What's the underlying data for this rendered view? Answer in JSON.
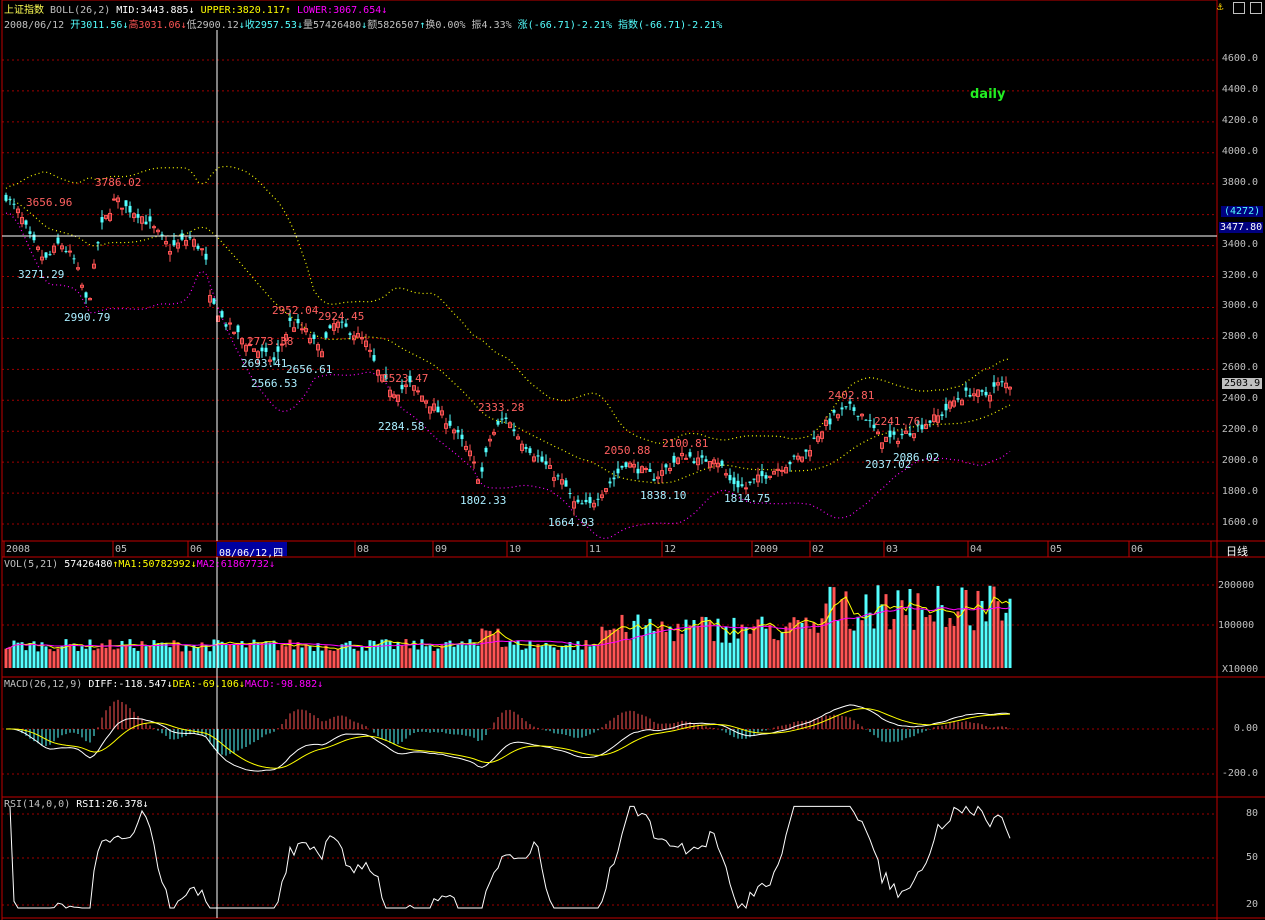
{
  "header": {
    "name": "上证指数",
    "boll_label": "BOLL(26,2)",
    "mid": "MID:3443.885",
    "upper": "UPPER:3820.117",
    "lower": "LOWER:3067.654",
    "date": "2008/06/12",
    "open": "开3011.56",
    "high": "高3031.06",
    "low": "低2900.12",
    "close": "收2957.53",
    "volume": "量57426480",
    "amount": "额5826507",
    "turnover": "换0.00%",
    "amplitude": "振4.33%",
    "change": "涨(-66.71)-2.21%",
    "index_change": "指数(-66.71)-2.21%"
  },
  "period_label": "daily",
  "price_axis": [
    "4600.0",
    "4400.0",
    "4200.0",
    "4000.0",
    "3800.0",
    "3600.0",
    "3400.0",
    "3200.0",
    "3000.0",
    "2800.0",
    "2600.0",
    "2400.0",
    "2200.0",
    "2000.0",
    "1800.0",
    "1600.0"
  ],
  "price_boxes": {
    "count": "(4272)",
    "crosshair_value": "3477.80",
    "last_price": "2503.9"
  },
  "annotations": [
    {
      "text": "3656.96",
      "kind": "hi"
    },
    {
      "text": "3786.02",
      "kind": "hi"
    },
    {
      "text": "3271.29",
      "kind": "lo"
    },
    {
      "text": "2990.79",
      "kind": "lo"
    },
    {
      "text": "2952.04",
      "kind": "hi"
    },
    {
      "text": "2924.45",
      "kind": "hi"
    },
    {
      "text": "2773.38",
      "kind": "hi"
    },
    {
      "text": "2693.41",
      "kind": "lo"
    },
    {
      "text": "2566.53",
      "kind": "lo"
    },
    {
      "text": "2656.61",
      "kind": "lo"
    },
    {
      "text": "2523.47",
      "kind": "hi"
    },
    {
      "text": "2284.58",
      "kind": "lo"
    },
    {
      "text": "2333.28",
      "kind": "hi"
    },
    {
      "text": "1802.33",
      "kind": "lo"
    },
    {
      "text": "1664.93",
      "kind": "lo"
    },
    {
      "text": "2050.88",
      "kind": "hi"
    },
    {
      "text": "2100.81",
      "kind": "hi"
    },
    {
      "text": "1838.10",
      "kind": "lo"
    },
    {
      "text": "1814.75",
      "kind": "lo"
    },
    {
      "text": "2402.81",
      "kind": "hi"
    },
    {
      "text": "2241.76",
      "kind": "hi"
    },
    {
      "text": "2037.02",
      "kind": "lo"
    },
    {
      "text": "2086.02",
      "kind": "lo"
    }
  ],
  "x_axis": [
    "2008",
    "05",
    "06",
    "08/06/12,四",
    "08",
    "09",
    "10",
    "11",
    "12",
    "2009",
    "02",
    "03",
    "04",
    "05",
    "06"
  ],
  "x_axis_right": "日线",
  "vol": {
    "label": "VOL(5,21)",
    "value": "57426480",
    "ma1": "MA1:50782992",
    "ma2": "MA2:61867732",
    "axis": [
      "200000",
      "100000"
    ],
    "unit": "X10000"
  },
  "macd": {
    "label": "MACD(26,12,9)",
    "diff": "DIFF:-118.547",
    "dea": "DEA:-69.106",
    "macd": "MACD:-98.882",
    "axis": [
      "0.00",
      "-200.0"
    ]
  },
  "rsi": {
    "label": "RSI(14,0,0)",
    "rsi1": "RSI1:26.378",
    "axis": [
      "80",
      "50",
      "20"
    ]
  },
  "colors": {
    "up": "#ff5454",
    "down": "#54ffff",
    "grid": "#a00000",
    "boll_mid": "#ffff00",
    "boll_upper": "#ffff00",
    "boll_lower": "#ff00ff"
  }
}
